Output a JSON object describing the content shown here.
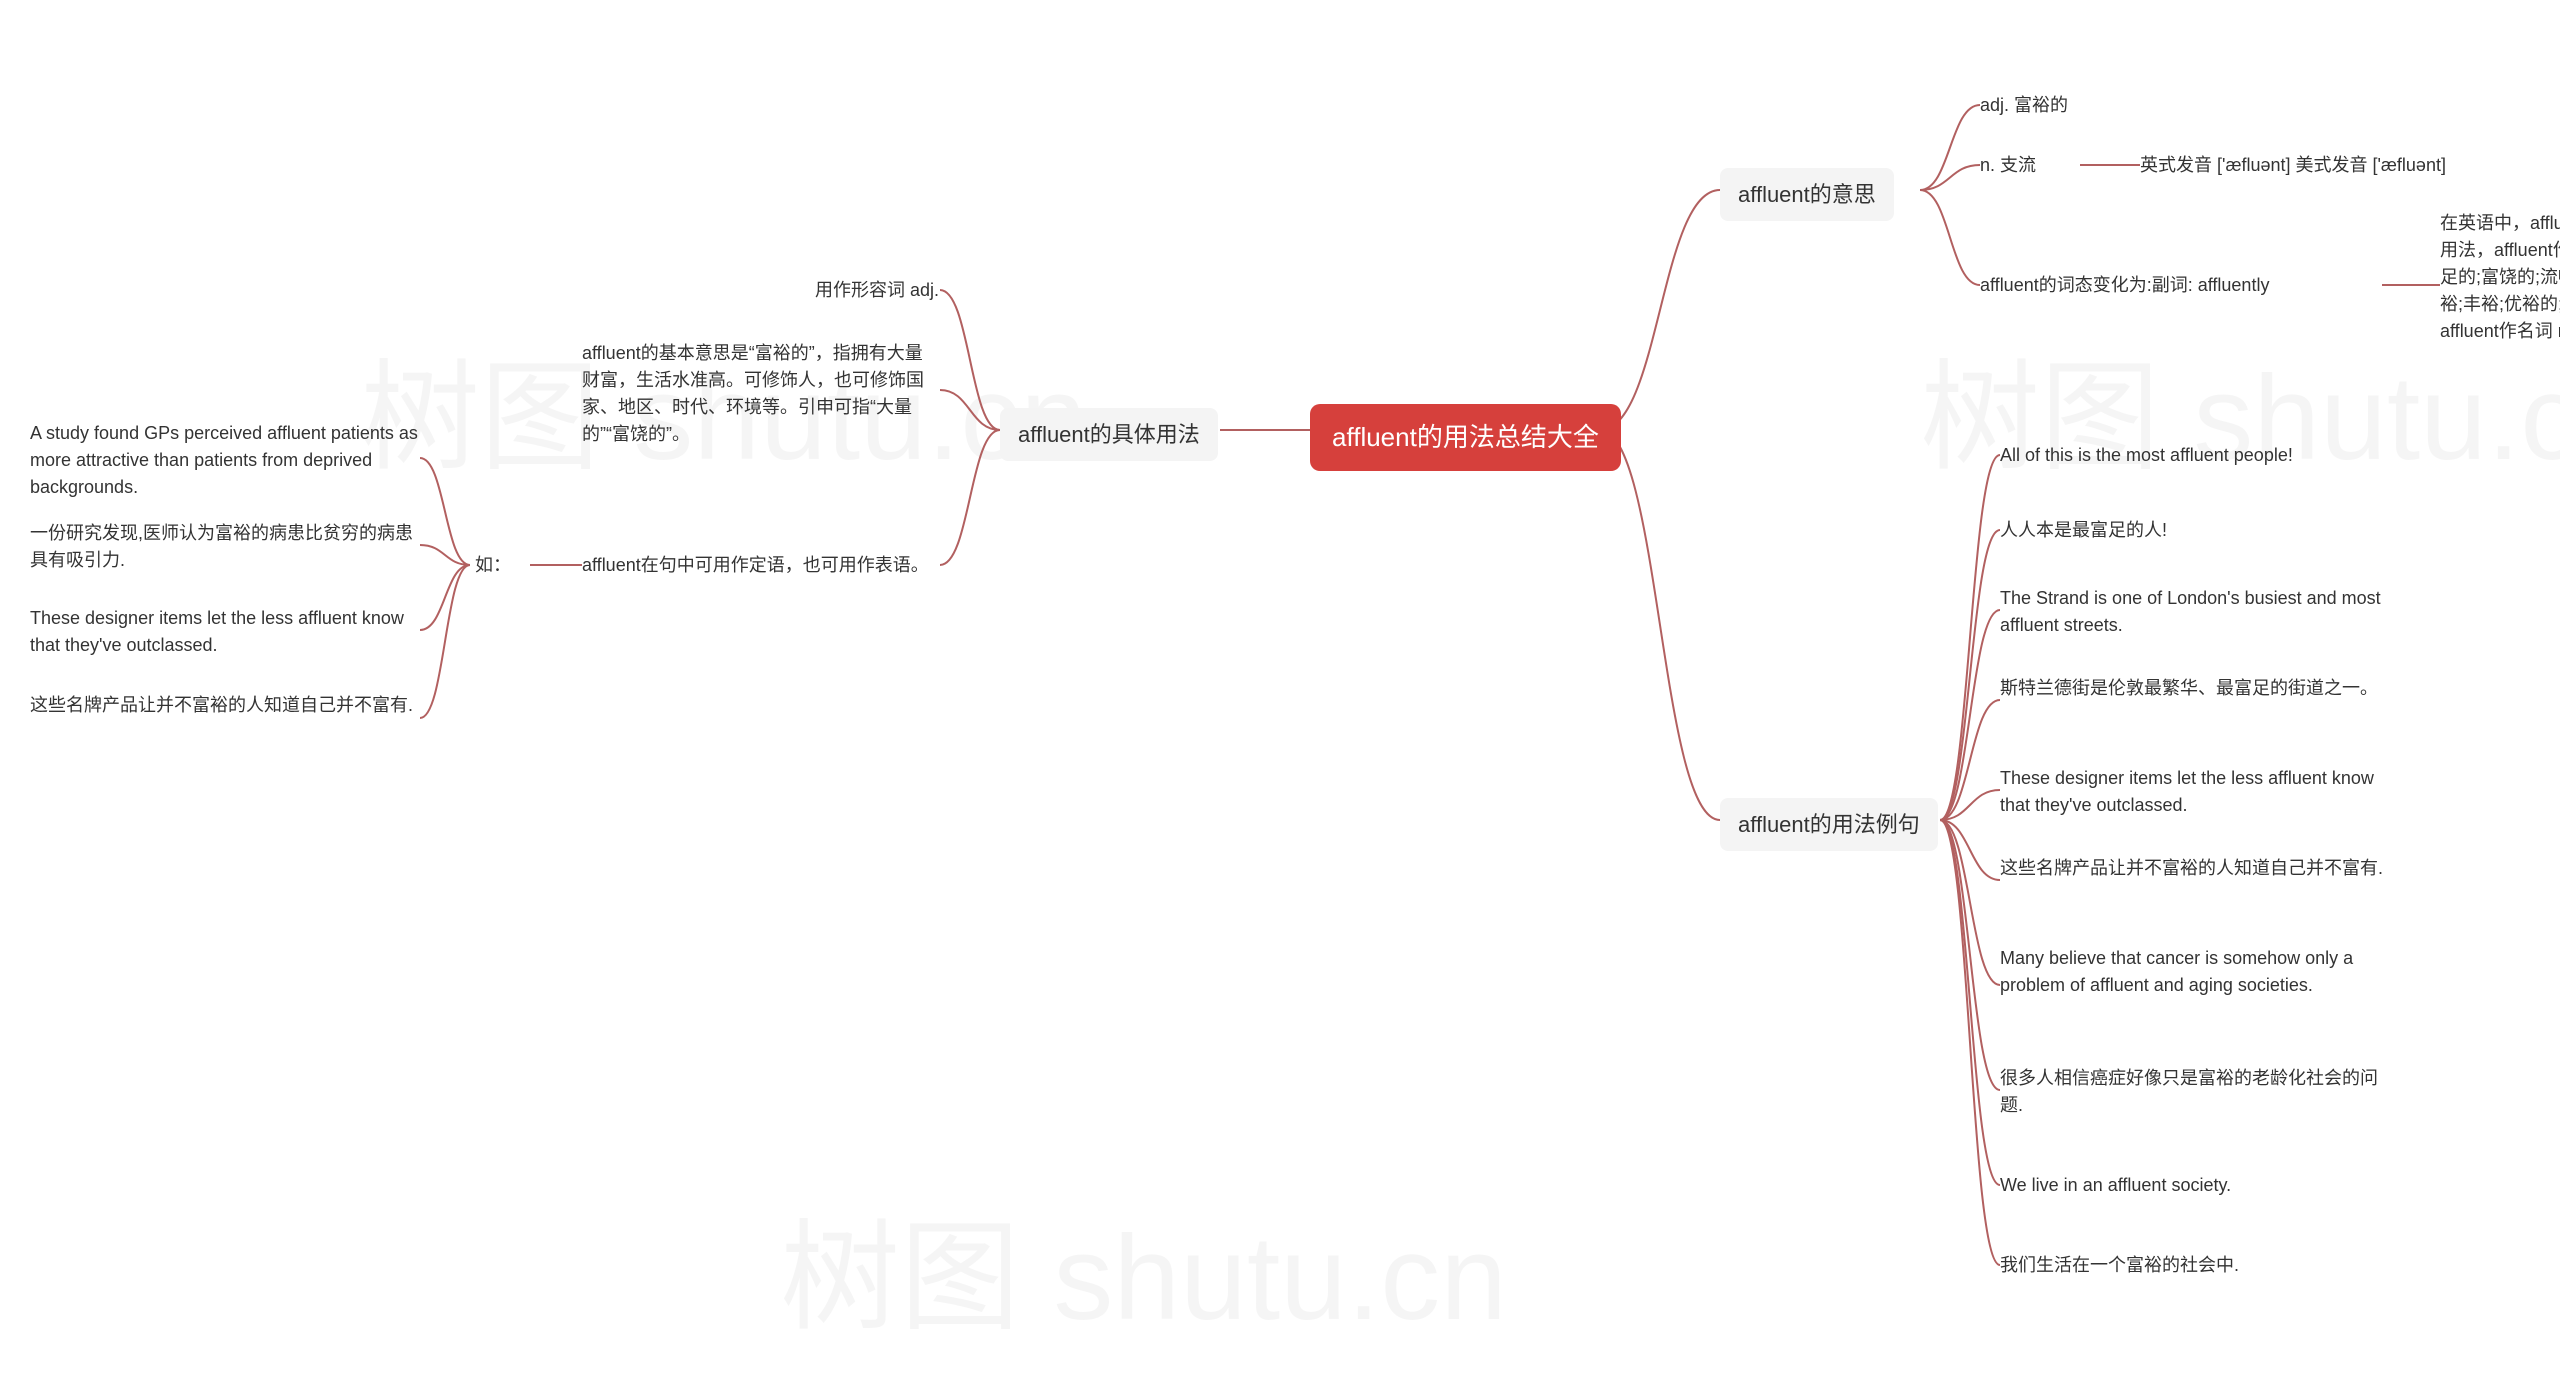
{
  "root": {
    "title": "affluent的用法总结大全"
  },
  "colors": {
    "root_bg": "#d6403c",
    "connector": "#b26060"
  },
  "watermarks": [
    "树图 shutu.cn",
    "树图 shutu.cn",
    "树图 shutu.cn"
  ],
  "right": {
    "meaning": {
      "title": "affluent的意思",
      "items": {
        "adj": "adj. 富裕的",
        "noun": "n. 支流",
        "pron": "英式发音 ['æfluənt] 美式发音 ['æfluənt]",
        "tense": "affluent的词态变化为:副词: affluently",
        "tense_detail": "在英语中，affluent不仅具有上述意思，还有更详尽的用法，affluent作形容词 adj. 时具有富裕的;丰富的;富足的;富饶的;流畅的;流入的;畅流的;滔滔的;富;富足;富裕;丰裕;优裕的;有钱;有钱人汇流的;繁荣的等意思，affluent作名词 n. 时具有支流;富裕的人;汇流等意思，"
      }
    },
    "examples": {
      "title": "affluent的用法例句",
      "items": [
        "All of this is the most affluent people!",
        "人人本是最富足的人!",
        "The Strand is one of London's busiest and most affluent streets.",
        "斯特兰德街是伦敦最繁华、最富足的街道之一。",
        "These designer items let the less affluent know that they've outclassed.",
        "这些名牌产品让并不富裕的人知道自己并不富有.",
        "Many believe that cancer is somehow only a problem of affluent and aging societies.",
        "很多人相信癌症好像只是富裕的老龄化社会的问题.",
        "We live in an affluent society.",
        "我们生活在一个富裕的社会中."
      ]
    }
  },
  "left": {
    "usage": {
      "title": "affluent的具体用法",
      "item1": "用作形容词 adj.",
      "item2": "affluent的基本意思是“富裕的”，指拥有大量财富，生活水准高。可修饰人，也可修饰国家、地区、时代、环境等。引申可指“大量的”“富饶的”。",
      "item3": "affluent在句中可用作定语，也可用作表语。",
      "item3_prefix": "如：",
      "item3_examples": [
        "A study found GPs perceived affluent patients as more attractive than patients from deprived backgrounds.",
        "一份研究发现,医师认为富裕的病患比贫穷的病患具有吸引力.",
        "These designer items let the less affluent know that they've outclassed.",
        "这些名牌产品让并不富裕的人知道自己并不富有."
      ]
    }
  }
}
